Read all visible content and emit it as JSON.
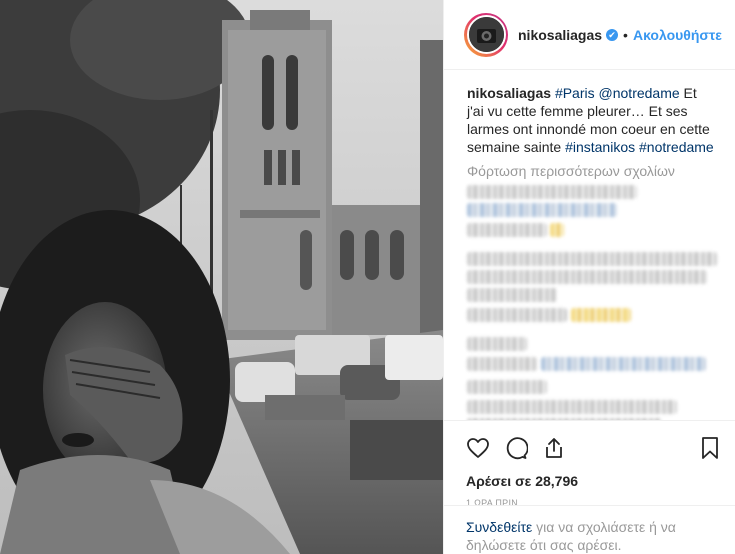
{
  "post": {
    "username": "nikosaliagas",
    "verified_glyph": "✔",
    "separator": "•",
    "follow_label": "Ακολουθήστε",
    "caption": {
      "username": "nikosaliagas",
      "tag_paris": "#Paris",
      "mention": "@notredame",
      "text": " Et j'ai vu cette femme pleurer… Et ses larmes ont innondé mon coeur en cette semaine sainte ",
      "tag_instanikos": "#instanikos",
      "tag_notredame": "#notredame"
    },
    "load_more_label": "Φόρτωση περισσότερων σχολίων",
    "likes_label": "Αρέσει σε 28,796",
    "time_label": "1 ΩΡΑ ΠΡΙΝ",
    "login_link": "Συνδεθείτε",
    "login_text": " για να σχολιάσετε ή να δηλώσετε ότι σας αρέσει."
  },
  "icons": {
    "like": "heart-icon",
    "comment": "comment-icon",
    "share": "share-icon",
    "save": "bookmark-icon",
    "verified": "verified-badge-icon"
  },
  "colors": {
    "link_blue": "#3897f0",
    "hashtag": "#003569",
    "muted": "#999999",
    "text": "#262626"
  }
}
